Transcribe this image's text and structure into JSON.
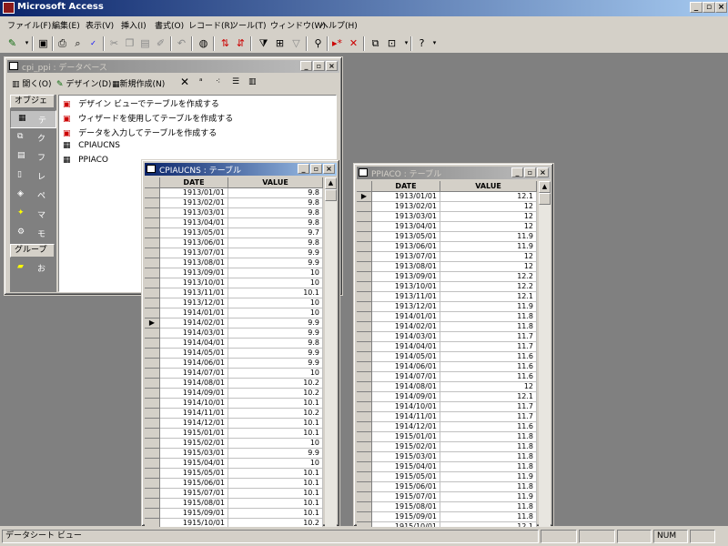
{
  "app": {
    "title": "Microsoft Access"
  },
  "window_buttons": {
    "minimize": "_",
    "restore": "▫",
    "close": "×"
  },
  "menu": [
    "ファイル(F)",
    "編集(E)",
    "表示(V)",
    "挿入(I)",
    "書式(O)",
    "レコード(R)",
    "ツール(T)",
    "ウィンドウ(W)",
    "ヘルプ(H)"
  ],
  "db_window": {
    "title": "cpi_ppi : データベース",
    "toolbar": {
      "open": "開く(O)",
      "design": "デザイン(D)",
      "new": "新規作成(N)"
    },
    "objects_header": "オブジェ",
    "groups_header": "グループ",
    "object_types": [
      "テ",
      "ク",
      "フ",
      "レ",
      "ペ",
      "マ",
      "モ"
    ],
    "group_items": [
      "お"
    ],
    "items": [
      "デザイン ビューでテーブルを作成する",
      "ウィザードを使用してテーブルを作成する",
      "データを入力してテーブルを作成する",
      "CPIAUCNS",
      "PPIACO"
    ]
  },
  "cpi_table": {
    "title": "CPIAUCNS : テーブル",
    "columns": [
      "DATE",
      "VALUE"
    ],
    "current_row_index": 13,
    "rows": [
      [
        "1913/01/01",
        "9.8"
      ],
      [
        "1913/02/01",
        "9.8"
      ],
      [
        "1913/03/01",
        "9.8"
      ],
      [
        "1913/04/01",
        "9.8"
      ],
      [
        "1913/05/01",
        "9.7"
      ],
      [
        "1913/06/01",
        "9.8"
      ],
      [
        "1913/07/01",
        "9.9"
      ],
      [
        "1913/08/01",
        "9.9"
      ],
      [
        "1913/09/01",
        "10"
      ],
      [
        "1913/10/01",
        "10"
      ],
      [
        "1913/11/01",
        "10.1"
      ],
      [
        "1913/12/01",
        "10"
      ],
      [
        "1914/01/01",
        "10"
      ],
      [
        "1914/02/01",
        "9.9"
      ],
      [
        "1914/03/01",
        "9.9"
      ],
      [
        "1914/04/01",
        "9.8"
      ],
      [
        "1914/05/01",
        "9.9"
      ],
      [
        "1914/06/01",
        "9.9"
      ],
      [
        "1914/07/01",
        "10"
      ],
      [
        "1914/08/01",
        "10.2"
      ],
      [
        "1914/09/01",
        "10.2"
      ],
      [
        "1914/10/01",
        "10.1"
      ],
      [
        "1914/11/01",
        "10.2"
      ],
      [
        "1914/12/01",
        "10.1"
      ],
      [
        "1915/01/01",
        "10.1"
      ],
      [
        "1915/02/01",
        "10"
      ],
      [
        "1915/03/01",
        "9.9"
      ],
      [
        "1915/04/01",
        "10"
      ],
      [
        "1915/05/01",
        "10.1"
      ],
      [
        "1915/06/01",
        "10.1"
      ],
      [
        "1915/07/01",
        "10.1"
      ],
      [
        "1915/08/01",
        "10.1"
      ],
      [
        "1915/09/01",
        "10.1"
      ],
      [
        "1915/10/01",
        "10.2"
      ]
    ]
  },
  "ppi_table": {
    "title": "PPIACO : テーブル",
    "columns": [
      "DATE",
      "VALUE"
    ],
    "current_row_index": 0,
    "rows": [
      [
        "1913/01/01",
        "12.1"
      ],
      [
        "1913/02/01",
        "12"
      ],
      [
        "1913/03/01",
        "12"
      ],
      [
        "1913/04/01",
        "12"
      ],
      [
        "1913/05/01",
        "11.9"
      ],
      [
        "1913/06/01",
        "11.9"
      ],
      [
        "1913/07/01",
        "12"
      ],
      [
        "1913/08/01",
        "12"
      ],
      [
        "1913/09/01",
        "12.2"
      ],
      [
        "1913/10/01",
        "12.2"
      ],
      [
        "1913/11/01",
        "12.1"
      ],
      [
        "1913/12/01",
        "11.9"
      ],
      [
        "1914/01/01",
        "11.8"
      ],
      [
        "1914/02/01",
        "11.8"
      ],
      [
        "1914/03/01",
        "11.7"
      ],
      [
        "1914/04/01",
        "11.7"
      ],
      [
        "1914/05/01",
        "11.6"
      ],
      [
        "1914/06/01",
        "11.6"
      ],
      [
        "1914/07/01",
        "11.6"
      ],
      [
        "1914/08/01",
        "12"
      ],
      [
        "1914/09/01",
        "12.1"
      ],
      [
        "1914/10/01",
        "11.7"
      ],
      [
        "1914/11/01",
        "11.7"
      ],
      [
        "1914/12/01",
        "11.6"
      ],
      [
        "1915/01/01",
        "11.8"
      ],
      [
        "1915/02/01",
        "11.8"
      ],
      [
        "1915/03/01",
        "11.8"
      ],
      [
        "1915/04/01",
        "11.8"
      ],
      [
        "1915/05/01",
        "11.9"
      ],
      [
        "1915/06/01",
        "11.8"
      ],
      [
        "1915/07/01",
        "11.9"
      ],
      [
        "1915/08/01",
        "11.8"
      ],
      [
        "1915/09/01",
        "11.8"
      ],
      [
        "1915/10/01",
        "12.1"
      ]
    ]
  },
  "status": {
    "mode": "データシート ビュー",
    "num": "NUM"
  }
}
